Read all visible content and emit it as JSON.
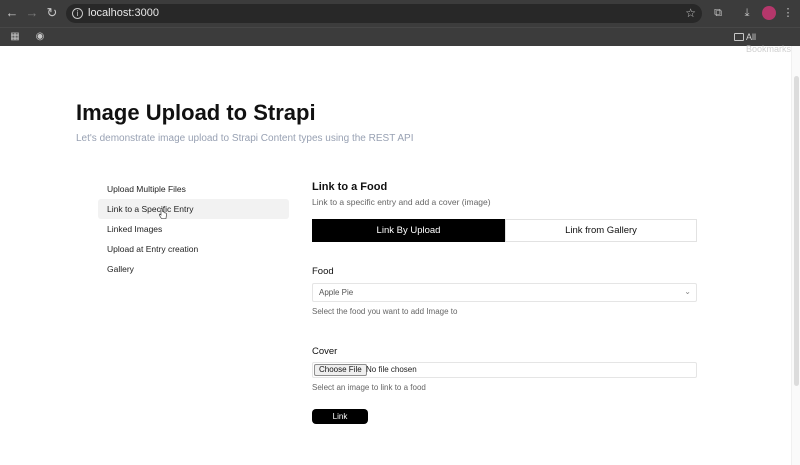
{
  "browser": {
    "url": "localhost:3000",
    "bookmarks_label": "All Bookmarks"
  },
  "page": {
    "title": "Image Upload to Strapi",
    "subtitle": "Let's demonstrate image upload to Strapi Content types using the REST API"
  },
  "sidebar": {
    "items": [
      {
        "label": "Upload Multiple Files"
      },
      {
        "label": "Link to a Specific Entry"
      },
      {
        "label": "Linked Images"
      },
      {
        "label": "Upload at Entry creation"
      },
      {
        "label": "Gallery"
      }
    ]
  },
  "main": {
    "section_title": "Link to a Food",
    "section_desc": "Link to a specific entry and add a cover (image)",
    "tabs": [
      {
        "label": "Link By Upload"
      },
      {
        "label": "Link from Gallery"
      }
    ],
    "food": {
      "label": "Food",
      "selected": "Apple Pie",
      "help": "Select the food you want to add Image to"
    },
    "cover": {
      "label": "Cover",
      "button_label": "Choose File",
      "status": "No file chosen",
      "help": "Select an image to link to a food"
    },
    "submit_label": "Link"
  }
}
